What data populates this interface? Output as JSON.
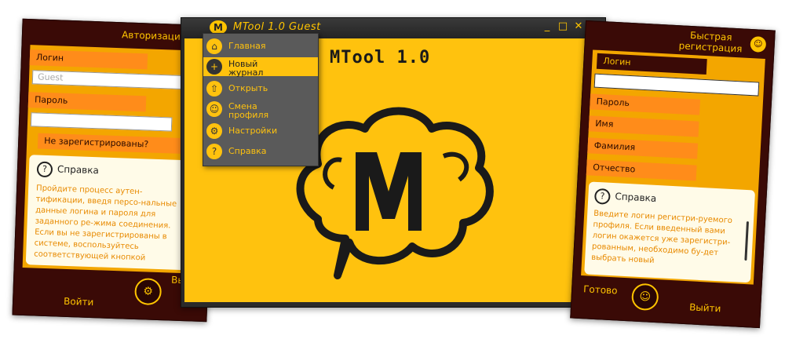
{
  "main_window": {
    "title": "MTool 1.0 Guest",
    "heading": "MTool 1.0",
    "controls": {
      "minimize": "_",
      "maximize": "□",
      "close": "✕"
    }
  },
  "menu": {
    "items": [
      {
        "label": "Главная",
        "icon": "home-icon",
        "glyph": "⌂"
      },
      {
        "label": "Новый\nжурнал",
        "icon": "new-journal-icon",
        "glyph": "+"
      },
      {
        "label": "Открыть",
        "icon": "open-icon",
        "glyph": "⇧"
      },
      {
        "label": "Смена\nпрофиля",
        "icon": "users-icon",
        "glyph": "☺"
      },
      {
        "label": "Настройки",
        "icon": "settings-icon",
        "glyph": "⚙"
      },
      {
        "label": "Справка",
        "icon": "help-icon",
        "glyph": "?"
      }
    ]
  },
  "auth_panel": {
    "title": "Авторизация",
    "login_label": "Логин",
    "login_placeholder": "Guest",
    "password_label": "Пароль",
    "not_registered": "Не зарегистрированы?",
    "help_title": "Справка",
    "help_text": "Пройдите процесс аутен-тификации, введя персо-нальные данные логина и пароля для заданного ре-жима соединения. Если вы не зарегистрированы в системе, воспользуйтесь соответствующей кнопкой",
    "login_button": "Войти",
    "exit_button": "Выйти"
  },
  "register_panel": {
    "title": "Быстрая\nрегистрация",
    "fields": [
      "Логин",
      "Пароль",
      "Имя",
      "Фамилия",
      "Отчество"
    ],
    "help_title": "Справка",
    "help_text": "Введите логин регистри-руемого профиля. Если введенный вами логин окажется уже зарегистри-рованным, необходимо бу-дет выбрать новый",
    "done_button": "Готово",
    "exit_button": "Выйти"
  },
  "colors": {
    "accent": "#ffc20e",
    "panel_dark": "#3a0a06",
    "tab_orange": "#ff8c1a"
  }
}
